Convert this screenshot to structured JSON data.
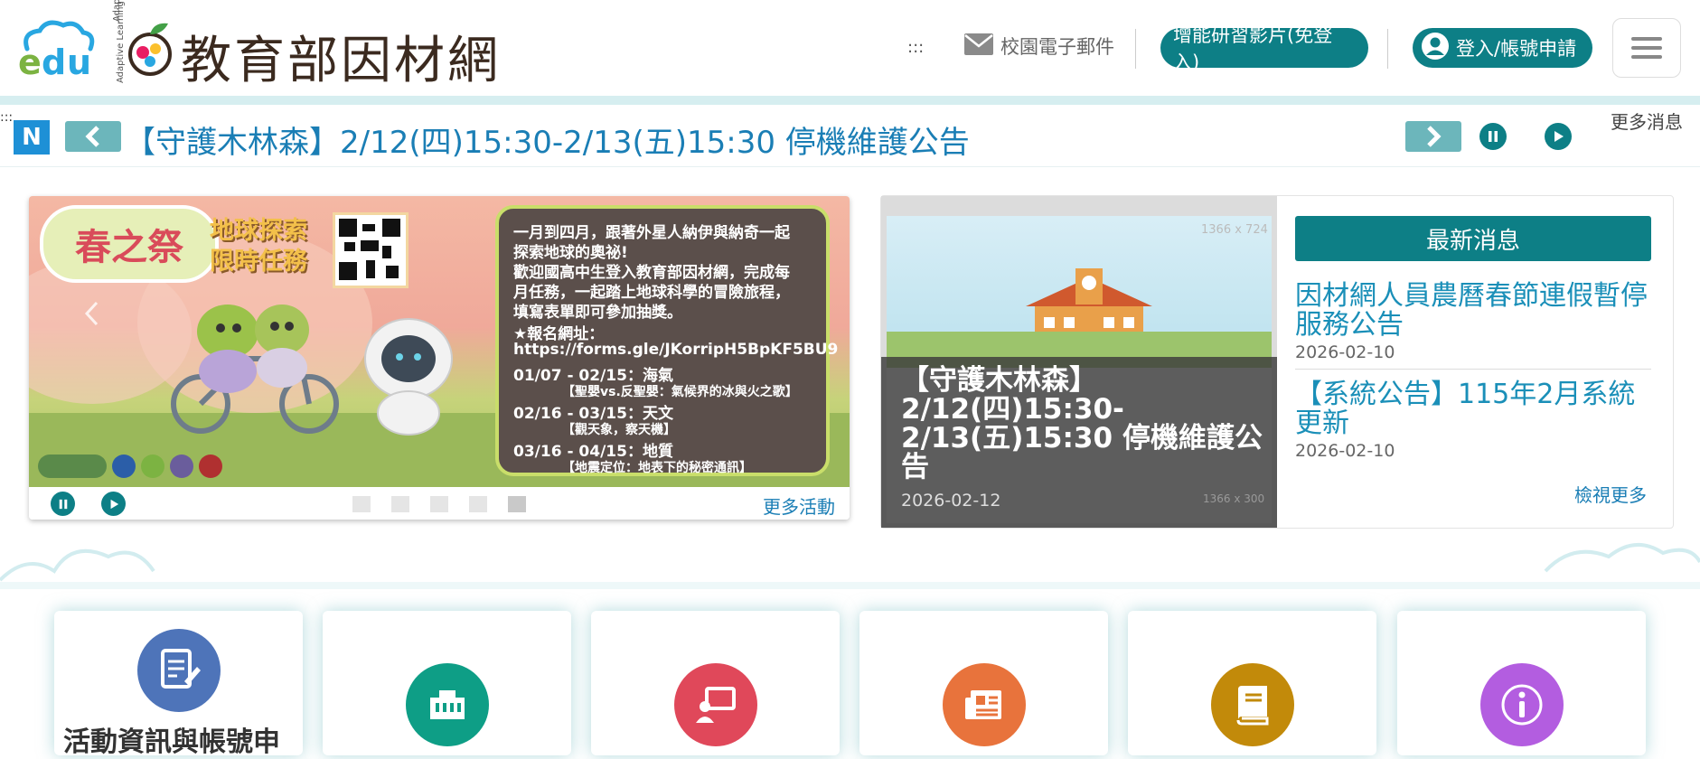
{
  "header": {
    "logo_text": "edu",
    "brand_small": "Adaptive Learning",
    "title": "教育部因材網",
    "dots": ":::",
    "mail_label": "校園電子郵件",
    "video_button": "增能研習影片(免登入)",
    "login_button": "登入/帳號申請"
  },
  "ticker": {
    "dots": ":::",
    "badge": "N",
    "text": "【守護木林森】2/12(四)15:30-2/13(五)15:30 停機維護公告",
    "more_label": "更多消息"
  },
  "banner": {
    "spring_label": "春之祭",
    "mission_line1": "地球探索",
    "mission_line2": "限時任務",
    "lines": [
      "一月到四月，跟著外星人納伊與納奇一起",
      "探索地球的奧祕!",
      "歡迎國高中生登入教育部因材網，完成每",
      "月任務，一起踏上地球科學的冒險旅程，",
      "填寫表單即可參加抽獎。",
      "★報名網址：",
      "https://forms.gle/JKorripH5BpKF5BU9"
    ],
    "schedule": [
      {
        "date": "01/07 - 02/15：海氣",
        "sub": "【聖嬰vs.反聖嬰：氣候界的冰與火之歌】"
      },
      {
        "date": "02/16 - 03/15：天文",
        "sub": "【觀天象，察天機】"
      },
      {
        "date": "03/16 - 04/15：地質",
        "sub": "【地震定位：地表下的秘密通訊】"
      }
    ],
    "more_label": "更多活動",
    "slide_count": 5,
    "active_slide": 5
  },
  "news": {
    "image_placeholder_top": "1366 x 724",
    "image_placeholder_bottom": "1366 x 300",
    "caption_title": "【守護木林森】2/12(四)15:30-2/13(五)15:30 停機維護公告",
    "caption_date": "2026-02-12",
    "heading": "最新消息",
    "items": [
      {
        "title": "因材網人員農曆春節連假暫停服務公告",
        "date": "2026-02-10"
      },
      {
        "title": "【系統公告】115年2月系統更新",
        "date": "2026-02-10"
      }
    ],
    "view_more": "檢視更多"
  },
  "cards": [
    {
      "label": "活動資訊與帳號申",
      "icon": "document-edit-icon",
      "color": "#4e74b9"
    },
    {
      "label": "",
      "icon": "network-icon",
      "color": "#0e9e86"
    },
    {
      "label": "",
      "icon": "presentation-icon",
      "color": "#e0485a"
    },
    {
      "label": "",
      "icon": "newspaper-icon",
      "color": "#e8733c"
    },
    {
      "label": "",
      "icon": "book-icon",
      "color": "#c28a0a"
    },
    {
      "label": "",
      "icon": "info-icon",
      "color": "#b35de0"
    }
  ],
  "colors": {
    "primary": "#0d7f86",
    "link": "#1a7eb5",
    "badge": "#1e90d6"
  }
}
